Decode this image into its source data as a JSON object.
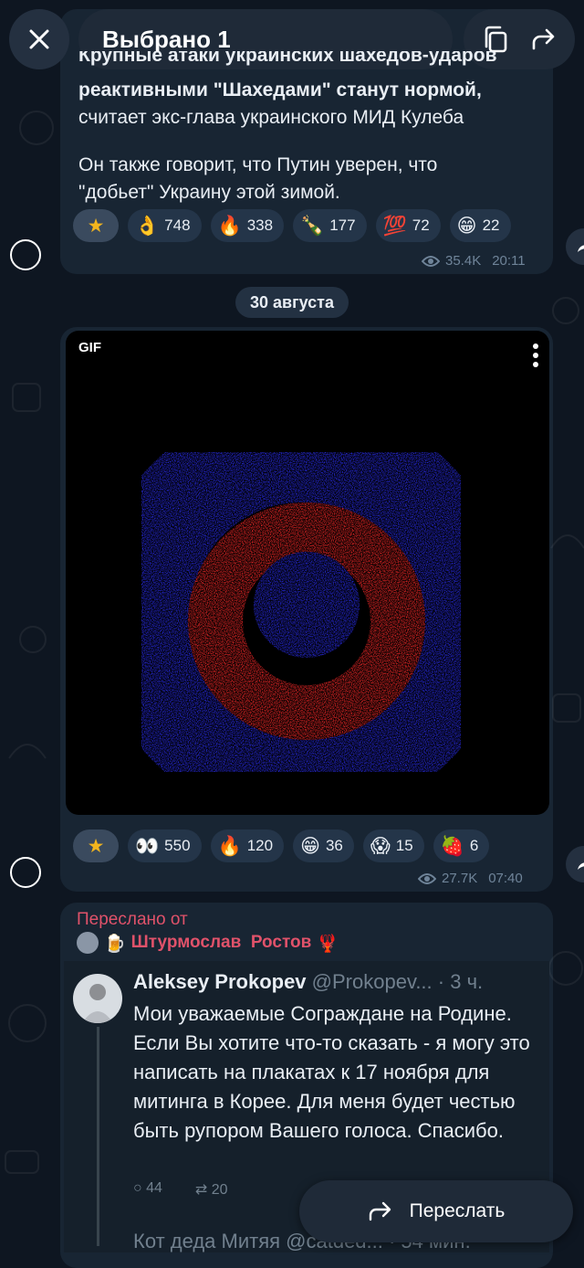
{
  "topbar": {
    "selected_label": "Выбрано 1",
    "close_icon": "close-icon",
    "copy_icon": "copy-icon",
    "forward_icon": "forward-arrow-icon"
  },
  "post1": {
    "line1_cut": "Крупные атаки украинских шахедов-ударов",
    "line2": "реактивными \"Шахедами\" станут нормой,",
    "line3": "считает экс-глава украинского МИД Кулеба",
    "line4": "Он также говорит, что Путин уверен, что",
    "line5": "\"добьет\" Украину этой зимой.",
    "reactions": [
      {
        "emoji": "👌",
        "count": "748"
      },
      {
        "emoji": "🔥",
        "count": "338"
      },
      {
        "emoji": "🍾",
        "count": "177"
      },
      {
        "emoji": "💯",
        "count": "72"
      },
      {
        "emoji": "😁",
        "count": "22"
      }
    ],
    "views": "35.4K",
    "time": "20:11"
  },
  "date_separator": "30 августа",
  "post2": {
    "gif_label": "GIF",
    "reactions": [
      {
        "emoji": "👀",
        "count": "550"
      },
      {
        "emoji": "🔥",
        "count": "120"
      },
      {
        "emoji": "😁",
        "count": "36"
      },
      {
        "emoji": "😱",
        "count": "15"
      },
      {
        "emoji": "🍓",
        "count": "6"
      }
    ],
    "views": "27.7K",
    "time": "07:40"
  },
  "post3": {
    "forwarded_label": "Переслано от",
    "forwarded_from": "Штурмослав  Ростов",
    "tweet": {
      "author": "Aleksey Prokopev",
      "handle": "@Prokopev...",
      "age": "· 3 ч.",
      "text": "Мои уважаемые Сограждане на Родине. Если Вы хотите что-то сказать - я могу это написать на плакатах к 17 ноября для митинга в Корее. Для меня будет честью быть рупором Вашего голоса. Спасибо.",
      "replies": "44",
      "retweets": "20",
      "next_author": "Кот деда Митяя @catded... · 54 мин."
    }
  },
  "forward_button": {
    "label": "Переслать"
  },
  "colors": {
    "background": "#0e1621",
    "bubble": "#182533",
    "accent_red": "#e0526a",
    "gif_blue": "#2a2df0",
    "gif_red": "#ff2a2a"
  }
}
